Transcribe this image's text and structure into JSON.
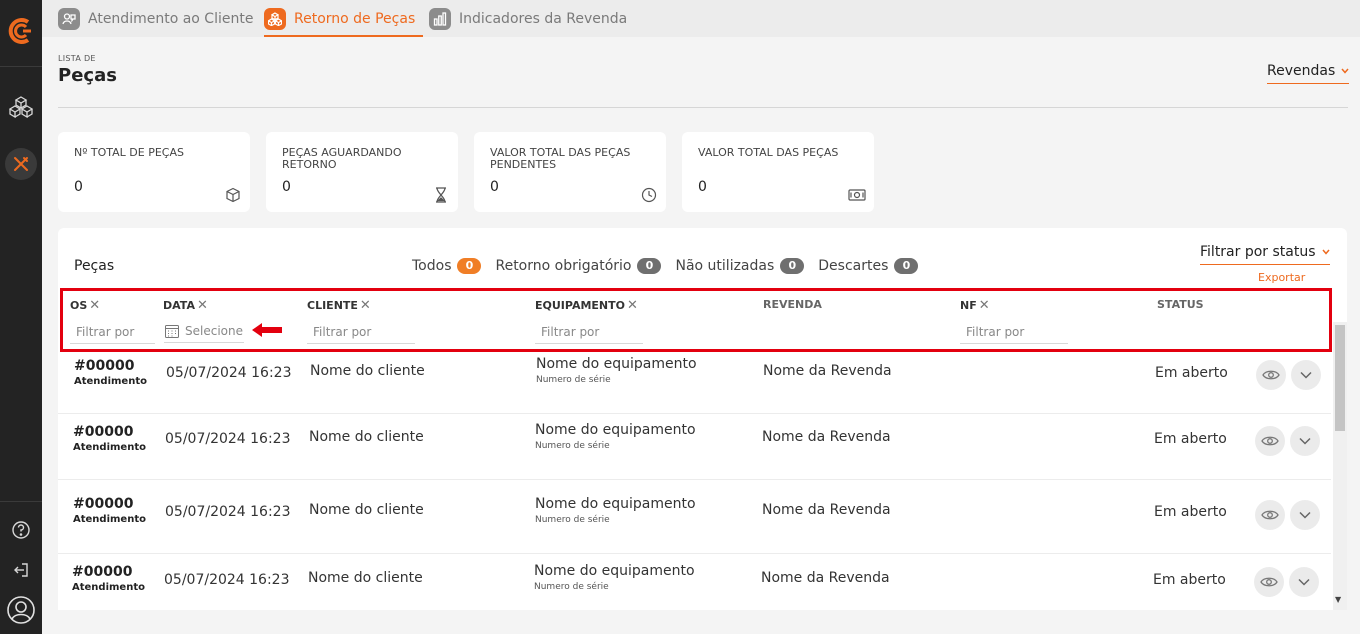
{
  "nav_tabs": [
    {
      "label": "Atendimento ao Cliente",
      "icon": "support-icon",
      "active": false
    },
    {
      "label": "Retorno de Peças",
      "icon": "parts-icon",
      "active": true
    },
    {
      "label": "Indicadores da Revenda",
      "icon": "chart-icon",
      "active": false
    }
  ],
  "header": {
    "eyebrow": "LISTA DE",
    "title": "Peças",
    "revendas_label": "Revendas"
  },
  "cards": [
    {
      "label": "Nº TOTAL DE PEÇAS",
      "value": "0",
      "icon": "cube-icon"
    },
    {
      "label": "PEÇAS AGUARDANDO RETORNO",
      "value": "0",
      "icon": "hourglass-icon"
    },
    {
      "label": "VALOR TOTAL DAS PEÇAS PENDENTES",
      "value": "0",
      "icon": "clock-icon"
    },
    {
      "label": "VALOR TOTAL DAS PEÇAS",
      "value": "0",
      "icon": "money-icon"
    }
  ],
  "panel": {
    "title": "Peças",
    "status_tabs": [
      {
        "label": "Todos",
        "count": "0",
        "active": true
      },
      {
        "label": "Retorno obrigatório",
        "count": "0"
      },
      {
        "label": "Não utilizadas",
        "count": "0"
      },
      {
        "label": "Descartes",
        "count": "0"
      }
    ],
    "filter_status_label": "Filtrar por status",
    "export_label": "Exportar"
  },
  "columns": {
    "os": "OS",
    "data": "DATA",
    "cliente": "CLIENTE",
    "equipamento": "EQUIPAMENTO",
    "revenda": "REVENDA",
    "nf": "NF",
    "status": "STATUS"
  },
  "filters": {
    "placeholder": "Filtrar por",
    "date_placeholder": "Selecione"
  },
  "rows": [
    {
      "os": "#00000",
      "os_sub": "Atendimento",
      "data": "05/07/2024 16:23",
      "cliente": "Nome do cliente",
      "equipamento": "Nome do equipamento",
      "serie": "Numero de série",
      "revenda": "Nome da Revenda",
      "status": "Em aberto"
    },
    {
      "os": "#00000",
      "os_sub": "Atendimento",
      "data": "05/07/2024 16:23",
      "cliente": "Nome do cliente",
      "equipamento": "Nome do equipamento",
      "serie": "Numero de série",
      "revenda": "Nome da Revenda",
      "status": "Em aberto"
    },
    {
      "os": "#00000",
      "os_sub": "Atendimento",
      "data": "05/07/2024 16:23",
      "cliente": "Nome do cliente",
      "equipamento": "Nome do equipamento",
      "serie": "Numero de série",
      "revenda": "Nome da Revenda",
      "status": "Em aberto"
    },
    {
      "os": "#00000",
      "os_sub": "Atendimento",
      "data": "05/07/2024 16:23",
      "cliente": "Nome do cliente",
      "equipamento": "Nome do equipamento",
      "serie": "Numero de série",
      "revenda": "Nome da Revenda",
      "status": "Em aberto"
    }
  ],
  "colors": {
    "accent": "#ee6a1f",
    "sidebar": "#232323",
    "highlight": "#e3000f"
  }
}
